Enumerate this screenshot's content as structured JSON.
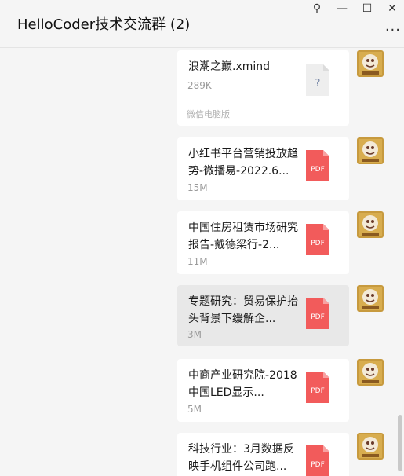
{
  "window": {
    "title": "HelloCoder技术交流群 (2)",
    "controls": {
      "pin": "⚲",
      "minimize": "—",
      "maximize": "☐",
      "close": "✕"
    },
    "more": "···"
  },
  "messages": [
    {
      "name": "浪潮之巅.xmind",
      "size": "289K",
      "source": "微信电脑版",
      "icon": "unknown-file-icon",
      "icon_text": "?"
    },
    {
      "name": "小红书平台营销投放趋势-微播易-2022.6...",
      "size": "15M",
      "icon": "pdf-file-icon",
      "icon_text": "PDF"
    },
    {
      "name": "中国住房租赁市场研究报告-戴德梁行-2...",
      "size": "11M",
      "icon": "pdf-file-icon",
      "icon_text": "PDF"
    },
    {
      "name": "专题研究：贸易保护抬头背景下缓解企...",
      "size": "3M",
      "icon": "pdf-file-icon",
      "icon_text": "PDF",
      "highlighted": true
    },
    {
      "name": "中商产业研究院-2018中国LED显示...",
      "size": "5M",
      "icon": "pdf-file-icon",
      "icon_text": "PDF"
    },
    {
      "name": "科技行业：3月数据反映手机组件公司跑...",
      "size": "",
      "icon": "pdf-file-icon",
      "icon_text": "PDF"
    }
  ],
  "colors": {
    "pdf": "#f25b5b",
    "unknown_file": "#eeeeee",
    "bubble": "#ffffff",
    "bubble_highlight": "#e8e8e8"
  }
}
